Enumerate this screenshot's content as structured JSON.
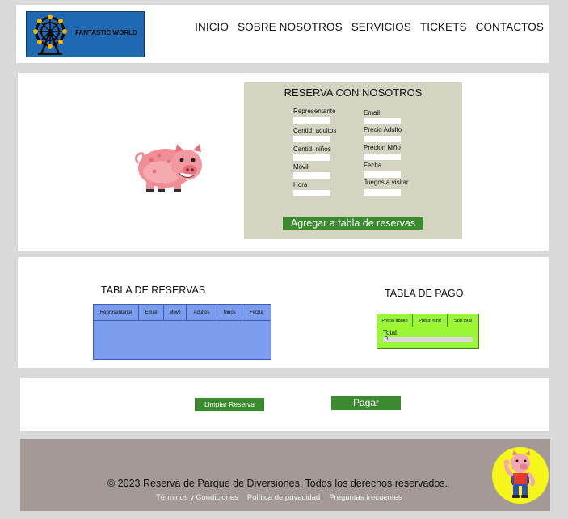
{
  "header": {
    "logo_text": "FANTASTIC WORLD",
    "nav": [
      "INICIO",
      "SOBRE NOSOTROS",
      "SERVICIOS",
      "TICKETS",
      "CONTACTOS"
    ]
  },
  "reservation": {
    "title": "RESERVA CON NOSOTROS",
    "fields_left": [
      "Representante",
      "Cantid. adultos",
      "Cantid. niños",
      "Móvil",
      "Hora"
    ],
    "fields_right": [
      "Email",
      "Precio Adulto",
      "Precion Niño",
      "Fecha",
      "Juegos a visitar"
    ],
    "submit_label": "Agregar a tabla de reservas"
  },
  "reservations_table": {
    "title": "TABLA DE RESERVAS",
    "columns": [
      "Representante",
      "Email",
      "Móvil",
      "Adultos",
      "Niños",
      "Fecha"
    ]
  },
  "payment_table": {
    "title": "TABLA DE PAGO",
    "columns": [
      "Precio adulto",
      "Precio niño",
      "Sub total"
    ],
    "total_label": "Total:",
    "total_value": "0"
  },
  "actions": {
    "clear_label": "Limpiar Reserva",
    "pay_label": "Pagar"
  },
  "footer": {
    "copyright": "© 2023 Reserva de Parque de Diversiones. Todos los derechos reservados.",
    "links": [
      "Términos y Condiciones",
      "Política de privacidad",
      "Preguntas frecuentes"
    ]
  },
  "colors": {
    "page_bg": "#d9d9d9",
    "logo_bg": "#1f69b3",
    "form_bg": "#d5d4c2",
    "button_green": "#3b8a2f",
    "reservations_table_bg": "#7b9ded",
    "payment_table_bg": "#9af53b",
    "footer_bg": "#a39a97"
  }
}
